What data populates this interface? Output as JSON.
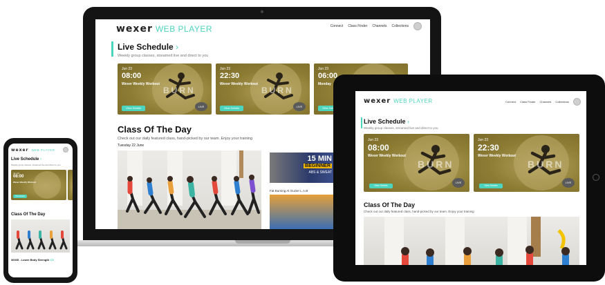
{
  "app": {
    "brand": "wexer",
    "product": "WEB PLAYER",
    "nav": [
      "Connect",
      "Class Finder",
      "Channels",
      "Collections"
    ]
  },
  "live_schedule": {
    "title": "Live Schedule",
    "arrow": "›",
    "subtitle": "Weekly group classes, streamed live and direct to you",
    "cards": [
      {
        "date": "Jun 23",
        "time": "08:00",
        "name": "Wexer Weekly Workout",
        "art": "BURN",
        "button": "View Details",
        "badge": "LIVE"
      },
      {
        "date": "Jun 23",
        "time": "22:30",
        "name": "Wexer Weekly Workout",
        "art": "BURN",
        "button": "View Details",
        "badge": "LIVE"
      },
      {
        "date": "Jun 23",
        "time": "06:00",
        "name": "Monday",
        "art": "BURN",
        "button": "View Details",
        "badge": "LIVE"
      }
    ]
  },
  "class_of_day": {
    "title": "Class Of The Day",
    "subtitle": "Check out our daily featured class, hand-picked by our team. Enjoy your training",
    "date": "Tuesday 22 June"
  },
  "side_thumbs": [
    {
      "big": "15 MIN",
      "line2": "BEGINNER",
      "line3": "ABS & SWEAT"
    },
    {
      "caption": "Fat Burning At Guzier L.A.B"
    }
  ],
  "phone": {
    "brand": "wexer",
    "product": "WEB PLAYER",
    "class_title": "30035 - Lower Body Strength",
    "class_badge": "CD"
  },
  "colors": {
    "accent": "#4dd4bf",
    "card_olive": "#8e7f34",
    "device_black": "#141414"
  },
  "icons": [
    "user-avatar-icon",
    "chevron-right-icon",
    "live-badge-icon"
  ]
}
